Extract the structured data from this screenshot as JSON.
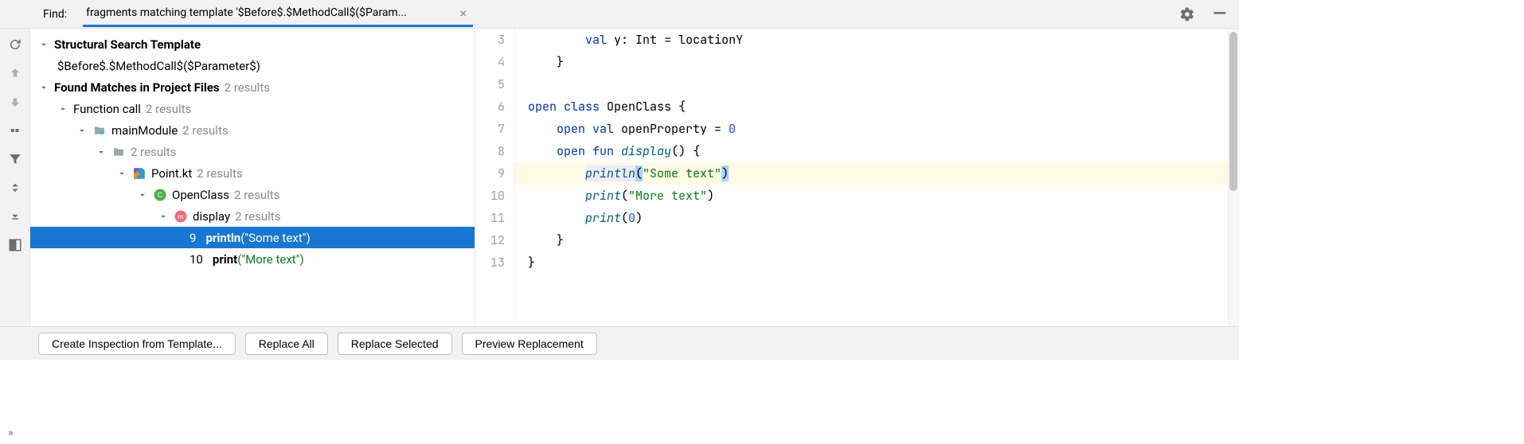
{
  "find": {
    "label": "Find:",
    "query": "fragments matching template '$Before$.$MethodCall$($Param..."
  },
  "tree": {
    "template_header": "Structural Search Template",
    "template_value": "$Before$.$MethodCall$($Parameter$)",
    "found_header": "Found Matches in Project Files",
    "found_count": "2 results",
    "fn_call": "Function call",
    "fn_call_count": "2 results",
    "module_name": "mainModule",
    "module_count": "2 results",
    "pkg_count": "2 results",
    "file_name": "Point.kt",
    "file_count": "2 results",
    "class_name": "OpenClass",
    "class_count": "2 results",
    "method_name": "display",
    "method_count": "2 results",
    "match1_line": "9",
    "match1_fn": "println",
    "match1_arg": "(\"Some text\")",
    "match2_line": "10",
    "match2_fn": "print",
    "match2_arg": "(\"More text\")"
  },
  "code": {
    "lines": [
      "3",
      "4",
      "5",
      "6",
      "7",
      "8",
      "9",
      "10",
      "11",
      "12",
      "13"
    ]
  },
  "buttons": {
    "create": "Create Inspection from Template...",
    "replace_all": "Replace All",
    "replace_selected": "Replace Selected",
    "preview": "Preview Replacement"
  }
}
